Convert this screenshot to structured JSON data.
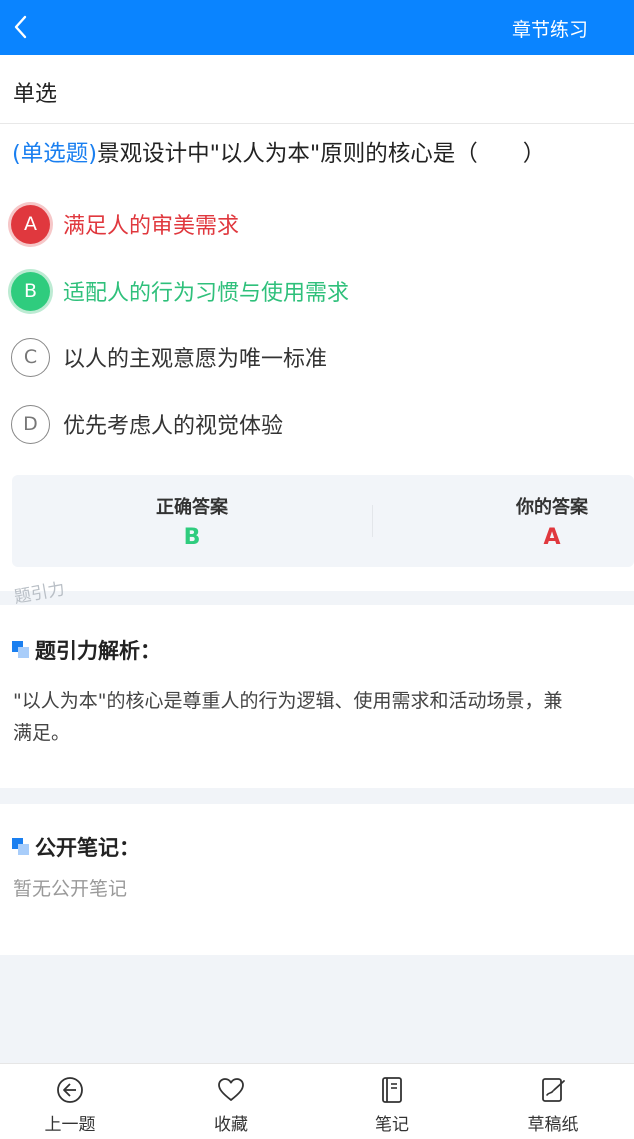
{
  "header": {
    "title": "章节练习",
    "back_icon": "chevron-left-icon"
  },
  "question_type_label": "单选",
  "question": {
    "type_tag": "(单选题)",
    "text": "景观设计中\"以人为本\"原则的核心是（　　）"
  },
  "options": [
    {
      "letter": "A",
      "text": "满足人的审美需求",
      "state": "wrong"
    },
    {
      "letter": "B",
      "text": "适配人的行为习惯与使用需求",
      "state": "correct"
    },
    {
      "letter": "C",
      "text": "以人的主观意愿为唯一标准",
      "state": "normal"
    },
    {
      "letter": "D",
      "text": "优先考虑人的视觉体验",
      "state": "normal"
    }
  ],
  "answers": {
    "correct_label": "正确答案",
    "correct_value": "B",
    "yours_label": "你的答案",
    "yours_value": "A"
  },
  "watermark": "题引力",
  "analysis": {
    "title": "题引力解析：",
    "line1": "\"以人为本\"的核心是尊重人的行为逻辑、使用需求和活动场景，兼",
    "line2": "满足。"
  },
  "notes": {
    "title": "公开笔记：",
    "empty_text": "暂无公开笔记"
  },
  "bottom_tabs": [
    {
      "label": "上一题",
      "icon": "previous-circle-icon"
    },
    {
      "label": "收藏",
      "icon": "heart-icon"
    },
    {
      "label": "笔记",
      "icon": "notebook-icon"
    },
    {
      "label": "草稿纸",
      "icon": "scratch-paper-icon"
    }
  ],
  "colors": {
    "accent": "#0a84ff",
    "wrong": "#e0383e",
    "correct": "#2fcc7e"
  }
}
